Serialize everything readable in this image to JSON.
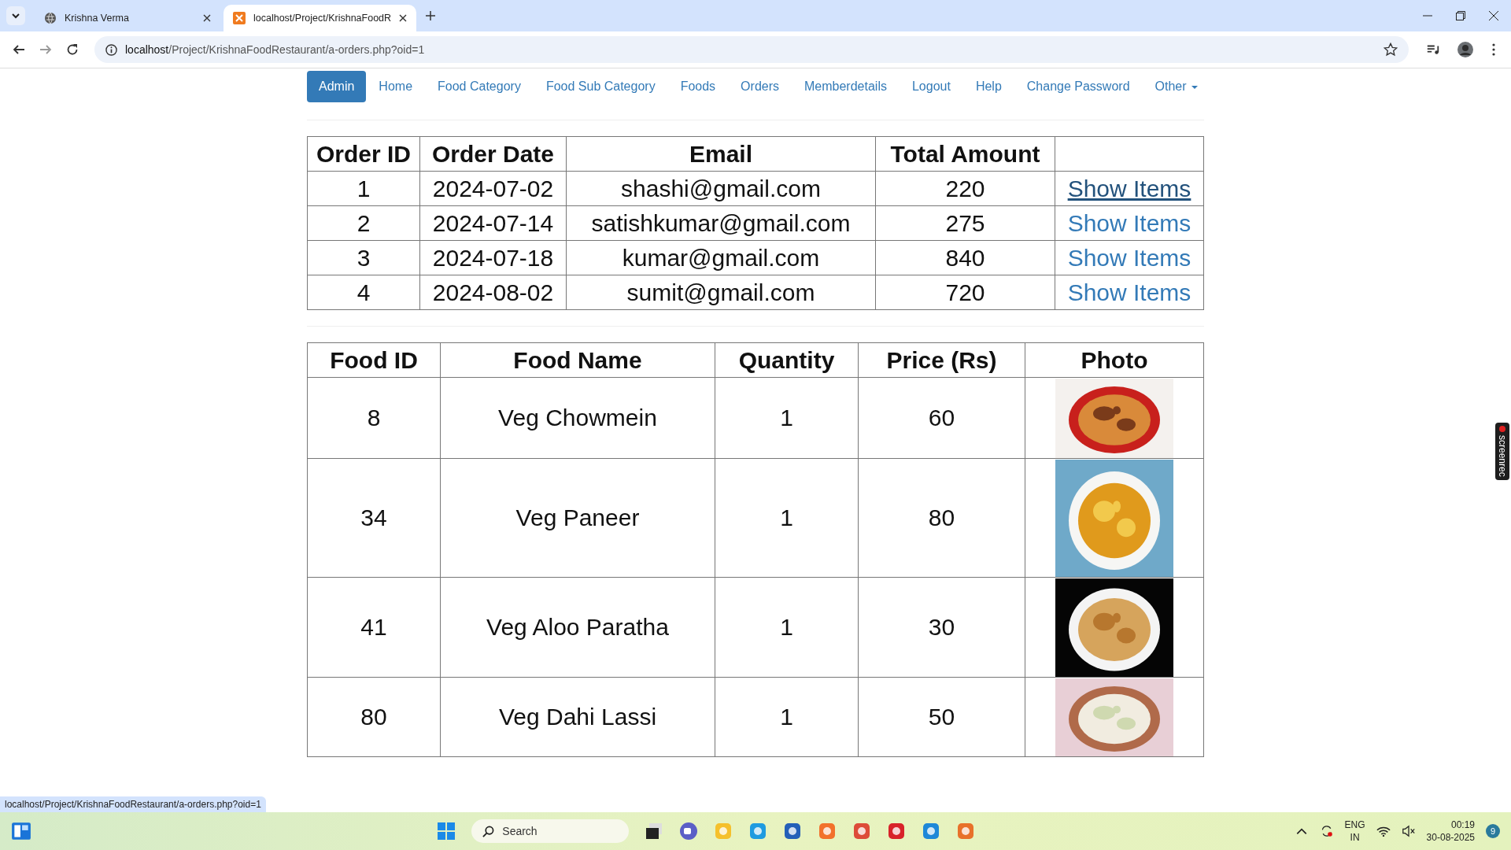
{
  "browser": {
    "tabs": [
      {
        "title": "Krishna Verma",
        "selected": false
      },
      {
        "title": "localhost/Project/KrishnaFoodR",
        "selected": true
      }
    ],
    "url_host": "localhost",
    "url_path": "/Project/KrishnaFoodRestaurant/a-orders.php?oid=1"
  },
  "nav": {
    "brand": "Admin",
    "items": [
      {
        "label": "Home",
        "kind": "link"
      },
      {
        "label": "Food Category",
        "kind": "link"
      },
      {
        "label": "Food Sub Category",
        "kind": "link"
      },
      {
        "label": "Foods",
        "kind": "link"
      },
      {
        "label": "Orders",
        "kind": "link"
      },
      {
        "label": "Memberdetails",
        "kind": "link"
      },
      {
        "label": "Logout",
        "kind": "link"
      },
      {
        "label": "Help",
        "kind": "link"
      },
      {
        "label": "Change Password",
        "kind": "link"
      },
      {
        "label": "Other",
        "kind": "dropdown"
      }
    ]
  },
  "orders": {
    "columns": [
      "Order ID",
      "Order Date",
      "Email",
      "Total Amount"
    ],
    "rows": [
      {
        "id": "1",
        "date": "2024-07-02",
        "email": "shashi@gmail.com",
        "total": "220",
        "link": "Show Items",
        "hovered": true
      },
      {
        "id": "2",
        "date": "2024-07-14",
        "email": "satishkumar@gmail.com",
        "total": "275",
        "link": "Show Items",
        "hovered": false
      },
      {
        "id": "3",
        "date": "2024-07-18",
        "email": "kumar@gmail.com",
        "total": "840",
        "link": "Show Items",
        "hovered": false
      },
      {
        "id": "4",
        "date": "2024-08-02",
        "email": "sumit@gmail.com",
        "total": "720",
        "link": "Show Items",
        "hovered": false
      }
    ]
  },
  "items": {
    "columns": [
      "Food ID",
      "Food Name",
      "Quantity",
      "Price (Rs)",
      "Photo"
    ],
    "rows": [
      {
        "id": "8",
        "name": "Veg Chowmein",
        "qty": "1",
        "price": "60"
      },
      {
        "id": "34",
        "name": "Veg Paneer",
        "qty": "1",
        "price": "80"
      },
      {
        "id": "41",
        "name": "Veg Aloo Paratha",
        "qty": "1",
        "price": "30"
      },
      {
        "id": "80",
        "name": "Veg Dahi Lassi",
        "qty": "1",
        "price": "50"
      }
    ]
  },
  "status_link": "localhost/Project/KrishnaFoodRestaurant/a-orders.php?oid=1",
  "recorder": {
    "label": "screenrec"
  },
  "taskbar": {
    "search_placeholder": "Search",
    "lang": "ENG",
    "region": "IN",
    "time": "00:19",
    "date": "30-08-2025",
    "notifications": "9"
  }
}
